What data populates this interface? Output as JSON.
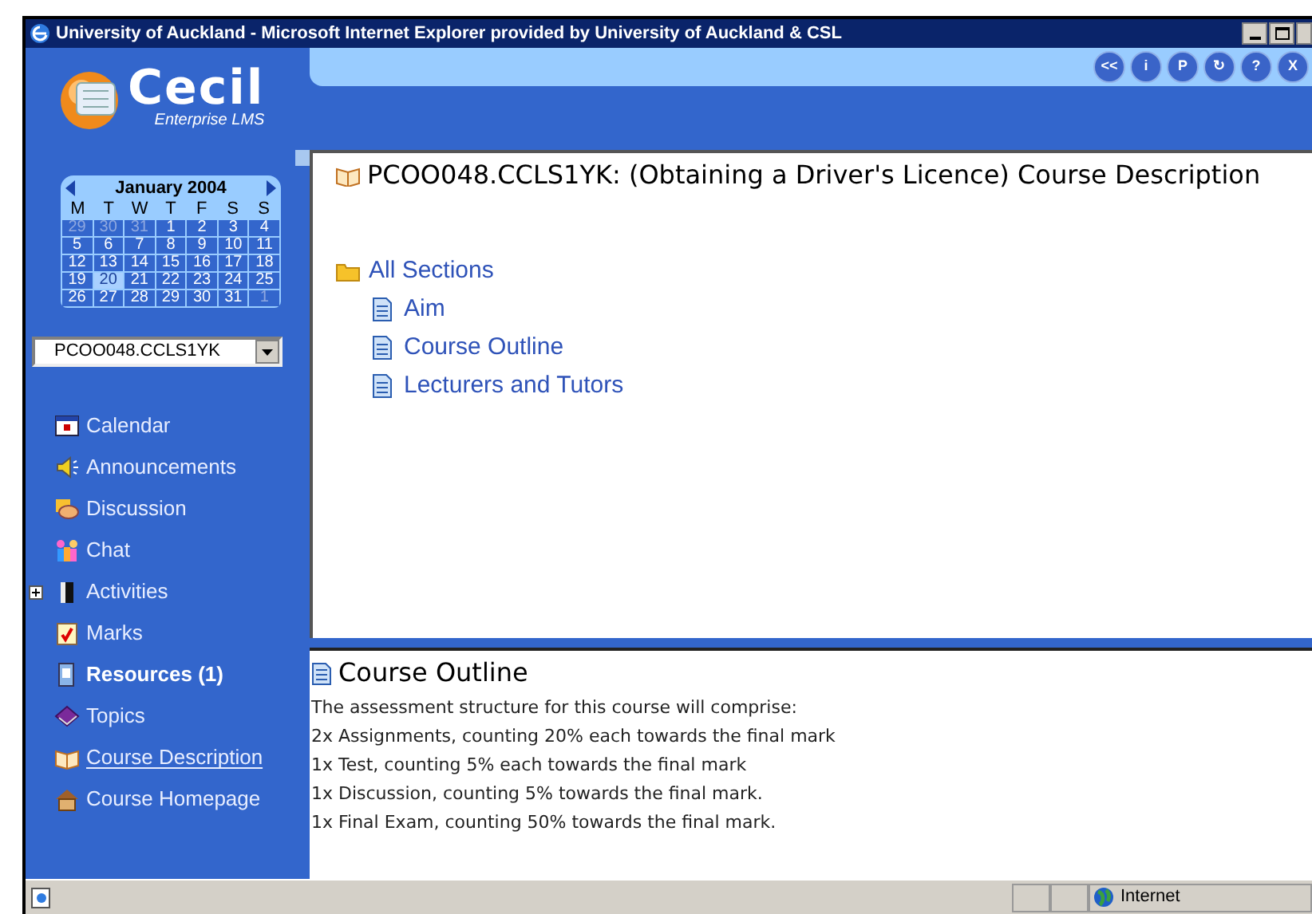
{
  "window": {
    "title": "University of Auckland - Microsoft Internet Explorer provided by University of Auckland & CSL"
  },
  "logo": {
    "name": "Cecil",
    "tagline": "Enterprise LMS"
  },
  "toolbar_buttons": [
    {
      "label": "<<"
    },
    {
      "label": "i"
    },
    {
      "label": "P"
    },
    {
      "label": "↻"
    },
    {
      "label": "?"
    },
    {
      "label": "X"
    }
  ],
  "calendar": {
    "month": "January 2004",
    "weekdays": [
      "M",
      "T",
      "W",
      "T",
      "F",
      "S",
      "S"
    ],
    "weeks": [
      [
        {
          "day": "29",
          "outside": true,
          "selected": false
        },
        {
          "day": "30",
          "outside": true,
          "selected": false
        },
        {
          "day": "31",
          "outside": true,
          "selected": false
        },
        {
          "day": "1",
          "outside": false,
          "selected": false
        },
        {
          "day": "2",
          "outside": false,
          "selected": false
        },
        {
          "day": "3",
          "outside": false,
          "selected": false
        },
        {
          "day": "4",
          "outside": false,
          "selected": false
        }
      ],
      [
        {
          "day": "5",
          "outside": false,
          "selected": false
        },
        {
          "day": "6",
          "outside": false,
          "selected": false
        },
        {
          "day": "7",
          "outside": false,
          "selected": false
        },
        {
          "day": "8",
          "outside": false,
          "selected": false
        },
        {
          "day": "9",
          "outside": false,
          "selected": false
        },
        {
          "day": "10",
          "outside": false,
          "selected": false
        },
        {
          "day": "11",
          "outside": false,
          "selected": false
        }
      ],
      [
        {
          "day": "12",
          "outside": false,
          "selected": false
        },
        {
          "day": "13",
          "outside": false,
          "selected": false
        },
        {
          "day": "14",
          "outside": false,
          "selected": false
        },
        {
          "day": "15",
          "outside": false,
          "selected": false
        },
        {
          "day": "16",
          "outside": false,
          "selected": false
        },
        {
          "day": "17",
          "outside": false,
          "selected": false
        },
        {
          "day": "18",
          "outside": false,
          "selected": false
        }
      ],
      [
        {
          "day": "19",
          "outside": false,
          "selected": false
        },
        {
          "day": "20",
          "outside": false,
          "selected": true
        },
        {
          "day": "21",
          "outside": false,
          "selected": false
        },
        {
          "day": "22",
          "outside": false,
          "selected": false
        },
        {
          "day": "23",
          "outside": false,
          "selected": false
        },
        {
          "day": "24",
          "outside": false,
          "selected": false
        },
        {
          "day": "25",
          "outside": false,
          "selected": false
        }
      ],
      [
        {
          "day": "26",
          "outside": false,
          "selected": false
        },
        {
          "day": "27",
          "outside": false,
          "selected": false
        },
        {
          "day": "28",
          "outside": false,
          "selected": false
        },
        {
          "day": "29",
          "outside": false,
          "selected": false
        },
        {
          "day": "30",
          "outside": false,
          "selected": false
        },
        {
          "day": "31",
          "outside": false,
          "selected": false
        },
        {
          "day": "1",
          "outside": true,
          "selected": false
        }
      ]
    ]
  },
  "course_select": {
    "value": "PCOO048.CCLS1YK"
  },
  "nav": [
    {
      "kind": "calendar",
      "label": "Calendar",
      "bold": false,
      "selected": false
    },
    {
      "kind": "announcements",
      "label": "Announcements",
      "bold": false,
      "selected": false
    },
    {
      "kind": "discussion",
      "label": "Discussion",
      "bold": false,
      "selected": false
    },
    {
      "kind": "chat",
      "label": "Chat",
      "bold": false,
      "selected": false
    },
    {
      "kind": "activities",
      "label": "Activities",
      "bold": false,
      "selected": false,
      "expanded": false
    },
    {
      "kind": "marks",
      "label": "Marks",
      "bold": false,
      "selected": false
    },
    {
      "kind": "resources",
      "label": "Resources (1)",
      "bold": true,
      "selected": false
    },
    {
      "kind": "topics",
      "label": "Topics",
      "bold": false,
      "selected": false
    },
    {
      "kind": "description",
      "label": "Course Description",
      "bold": false,
      "selected": true
    },
    {
      "kind": "homepage",
      "label": "Course Homepage",
      "bold": false,
      "selected": false
    }
  ],
  "content": {
    "title": "PCOO048.CCLS1YK: (Obtaining a Driver's Licence) Course Description",
    "tree": {
      "label": "All Sections",
      "children": [
        {
          "label": "Aim"
        },
        {
          "label": "Course Outline"
        },
        {
          "label": "Lecturers and Tutors"
        }
      ]
    }
  },
  "detail": {
    "title": "Course Outline",
    "lines": [
      "The assessment structure for this course will comprise:",
      "2x Assignments, counting 20% each towards the final mark",
      "1x Test, counting 5% each towards the final mark",
      "1x Discussion, counting 5% towards the final mark.",
      "1x Final Exam, counting 50% towards the final mark."
    ]
  },
  "status_bar": {
    "zone": "Internet"
  }
}
